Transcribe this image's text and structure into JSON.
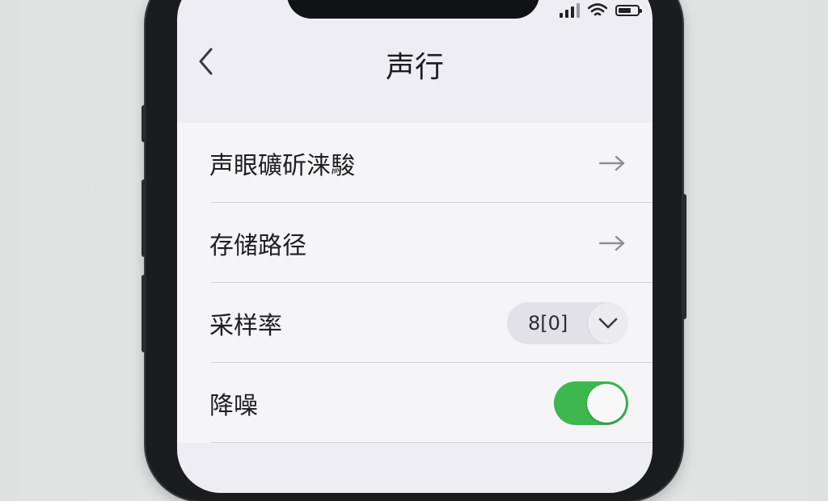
{
  "header": {
    "title": "声行",
    "back_icon": "chevron-left-icon"
  },
  "status_bar": {
    "signal_icon": "cellular-signal-icon",
    "wifi_icon": "wifi-icon",
    "battery_icon": "battery-icon"
  },
  "settings": {
    "items": [
      {
        "label": "声眼礦斫涞駿",
        "accessory": "arrow-right-icon"
      },
      {
        "label": "存储路径",
        "accessory": "arrow-right-icon"
      },
      {
        "label": "采样率",
        "value": "8[0]",
        "accessory": "chevron-down-icon"
      },
      {
        "label": "降噪",
        "toggle_on": true
      }
    ]
  },
  "colors": {
    "toggle_on": "#3cb84f",
    "background": "#eeeef2"
  }
}
